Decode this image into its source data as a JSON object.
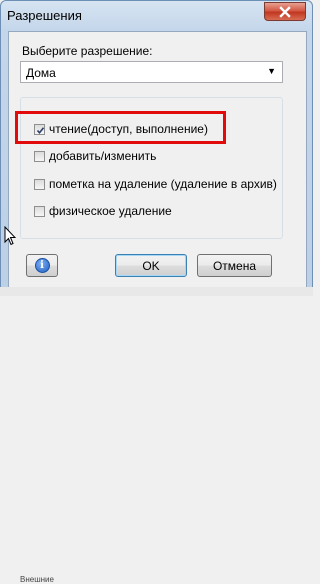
{
  "window": {
    "title": "Разрешения"
  },
  "permission": {
    "prompt": "Выберите разрешение:",
    "selected": "Дома"
  },
  "checkboxes": [
    {
      "label": "чтение(доступ, выполнение)",
      "checked": true
    },
    {
      "label": "добавить/изменить",
      "checked": false
    },
    {
      "label": "пометка на удаление (удаление в архив)",
      "checked": false
    },
    {
      "label": "физическое удаление",
      "checked": false
    }
  ],
  "buttons": {
    "ok": "OK",
    "cancel": "Отмена"
  },
  "background": {
    "partial_text": "Внешние"
  },
  "colors": {
    "highlight": "#e10b0b",
    "close": "#c0351f",
    "info": "#1d5fc7"
  }
}
